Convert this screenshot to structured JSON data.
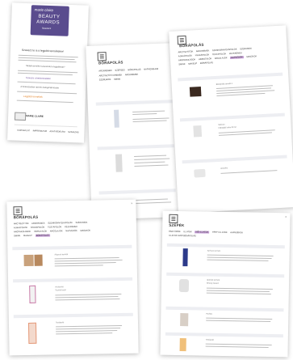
{
  "cards": {
    "award": {
      "brand": "marie claire",
      "badge_line1": "BEAUTY",
      "badge_line2": "AWARDS",
      "badge_sub": "Szavazz",
      "headline": "Szavazz te is a legjobb termékekre!",
      "question": "Melyik terméket szavaznád a legjobbnak?",
      "link_text": "Szavazz a kedvenceidre!",
      "rule_heading": "A Szavazásban nyertes kategóriák között",
      "cta": "Legjobb termékek",
      "footer_logo": "MARIE CLAIRE",
      "footer_links": [
        "KAPCSOLAT",
        "IMPRESSZUM",
        "ADATVÉDELEM",
        "SZAVAZÁS"
      ]
    },
    "mid": {
      "title": "BŐRÁPOLÁS",
      "nav": [
        "ARCKRÉMEK",
        "SZÉPSÉG",
        "BŐRÁPOLÁS",
        "NAPVÉDELEM"
      ],
      "cats": [
        "ARCTISZTÍTÓ KRÉMEK",
        "ARCKRÉMEK",
        "SZÉRUMOK",
        "SMINK"
      ]
    },
    "right": {
      "title": "BŐRÁPOLÁS",
      "nav_row1": [
        "ARCTISZTÍTÓK",
        "ARCKRÉMEK",
        "SZEMKÖRNYÉKÁPOLÓK",
        "SZÉRUMOK"
      ],
      "nav_row2": [
        "AJAKÁPOLÓK",
        "NYAKÁPOLÓK",
        "TESTÁPOLÓK",
        "KÉZKRÉMEK"
      ],
      "nav_row3": [
        "ARCPAKOLÁSOK",
        "HIDRATÁLÓK",
        "ARCOLAJOK",
        "NAPVÉDŐK",
        "MASZKOK"
      ],
      "nav_row4": [
        "SMINK",
        "MAKEUP",
        "BŐRÁPOLÁS"
      ],
      "highlight": "NAPVÉDŐK",
      "products": [
        {
          "title": "Bőrápolás termék 1",
          "brand": "Kozmetikum 100 ml"
        },
        {
          "title": "Szérum",
          "brand": "Hidratáló krém 50 ml"
        },
        {
          "title": "Arckrém",
          "brand": "Éjszakai krém 40 ml"
        }
      ]
    },
    "front_left": {
      "title": "BŐRÁPOLÁS",
      "nav_row1": [
        "ARCTISZTÍTÓK",
        "ARCKRÉMEK",
        "SZEMKÖRNYÉKÁPOLÓK",
        "SZÉRUMOK"
      ],
      "nav_row2": [
        "AJAKÁPOLÓK",
        "NYAKÁPOLÓK",
        "TESTÁPOLÓK",
        "KÉZKRÉMEK"
      ],
      "nav_row3": [
        "ARCPAKOLÁSOK",
        "HIDRATÁLÓK",
        "ARCOLAJOK",
        "NAPVÉDŐK",
        "MASZKOK"
      ],
      "nav_row4": [
        "SMINK",
        "MAKEUP",
        "BŐRÁPOLÁS"
      ],
      "highlight": "BŐRÁPOLÁS",
      "products": [
        {
          "title": "Alapozó termék",
          "brand": "Kozmetikum"
        },
        {
          "title": "Arctisztító",
          "brand": "Tisztító krém"
        },
        {
          "title": "Testápoló",
          "brand": "Hidratáló"
        }
      ]
    },
    "front_right": {
      "title": "SZÉPÉK",
      "nav_row1": [
        "PARFÜMÖK",
        "ILLATOK",
        "NŐI ILLATOK",
        "FÉRFI ILLATOK",
        "AJÁNDÉKOK"
      ],
      "nav_row2": [
        "ILLATOK SZÉPSÉGÁPOLÁS"
      ],
      "highlight": "NŐI ILLATOK",
      "products": [
        {
          "title": "Szérum termék",
          "brand": "Kozmetikum 30 ml"
        },
        {
          "title": "Ajánlott termék",
          "brand": "Beauty Award"
        },
        {
          "title": "Parfüm",
          "brand": "Eau de Parfum"
        },
        {
          "title": "Testápoló",
          "brand": "Napvédő krém"
        }
      ]
    }
  }
}
